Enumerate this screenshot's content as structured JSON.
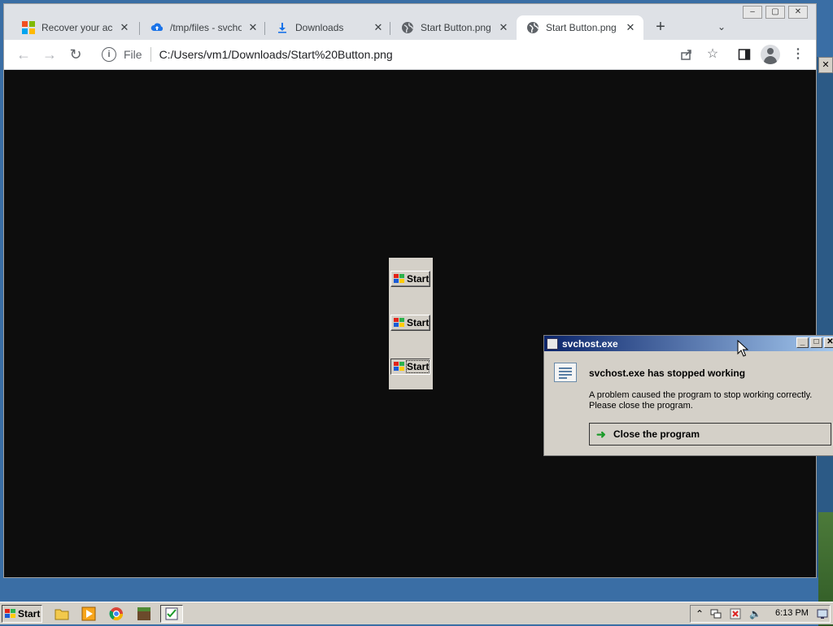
{
  "browser": {
    "tabs": [
      {
        "title": "Recover your acco",
        "icon": "microsoft-icon",
        "active": false
      },
      {
        "title": "/tmp/files - svcho",
        "icon": "cloud-upload-icon",
        "active": false
      },
      {
        "title": "Downloads",
        "icon": "download-icon",
        "active": false
      },
      {
        "title": "Start Button.png (",
        "icon": "globe-icon",
        "active": false
      },
      {
        "title": "Start Button.png (",
        "icon": "globe-icon",
        "active": true
      }
    ],
    "new_tab": "+",
    "tab_menu": "⌄",
    "address": {
      "scheme": "File",
      "url": "C:/Users/vm1/Downloads/Start%20Button.png"
    }
  },
  "image_viewer": {
    "buttons": [
      {
        "label": "Start",
        "state": "normal"
      },
      {
        "label": "Start",
        "state": "normal"
      },
      {
        "label": "Start",
        "state": "pressed"
      }
    ]
  },
  "dialog": {
    "title": "svchost.exe",
    "heading": "svchost.exe has stopped working",
    "message_line1": "A problem caused the program to stop working correctly.",
    "message_line2": "Please close the program.",
    "action": "Close the program"
  },
  "taskbar": {
    "start_label": "Start",
    "quicklaunch": [
      "folder-icon",
      "media-player-icon",
      "chrome-icon",
      "minecraft-icon",
      "task-icon"
    ],
    "clock": "6:13 PM"
  },
  "colors": {
    "titlebar_active": "#0a246a",
    "classic_face": "#d4d0c8",
    "chrome_tabbar": "#dee1e6"
  }
}
